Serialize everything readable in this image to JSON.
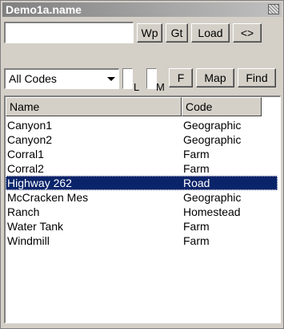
{
  "window": {
    "title": "Demo1a.name"
  },
  "toolbar": {
    "name_value": "",
    "wp_label": "Wp",
    "gt_label": "Gt",
    "load_label": "Load",
    "swap_label": "<>",
    "f_label": "F",
    "map_label": "Map",
    "find_label": "Find"
  },
  "filter": {
    "selected": "All Codes",
    "l_label": "L",
    "m_label": "M"
  },
  "list": {
    "columns": [
      "Name",
      "Code"
    ],
    "rows": [
      {
        "name": "Canyon1",
        "code": "Geographic"
      },
      {
        "name": "Canyon2",
        "code": "Geographic"
      },
      {
        "name": "Corral1",
        "code": "Farm"
      },
      {
        "name": "Corral2",
        "code": "Farm"
      },
      {
        "name": "Highway 262",
        "code": "Road"
      },
      {
        "name": "McCracken Mes",
        "code": "Geographic"
      },
      {
        "name": "Ranch",
        "code": "Homestead"
      },
      {
        "name": "Water Tank",
        "code": "Farm"
      },
      {
        "name": "Windmill",
        "code": "Farm"
      }
    ],
    "selected_index": 4
  },
  "colors": {
    "selection": "#0a246a",
    "face": "#d4d0c8"
  }
}
